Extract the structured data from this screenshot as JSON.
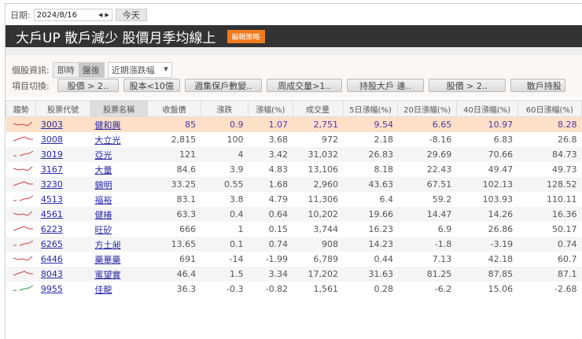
{
  "toolbar": {
    "date_label": "日期:",
    "date_value": "2024/8/16",
    "today_button": "今天"
  },
  "title": {
    "text": "大戶UP 散戶減少 股價月季均線上",
    "edit_button": "編輯策略"
  },
  "stock_info": {
    "label": "個股資訊:",
    "realtime": "即時",
    "after_hours": "盤後",
    "dropdown_value": "近期漲跌幅"
  },
  "item_switch": {
    "label": "項目切換:",
    "buttons": [
      "股價 > 2..",
      "股本<10億",
      "週集保戶數變..",
      "周成交量>1..",
      "持股大戶 連..",
      "股價 > 2..",
      "散戶持股"
    ]
  },
  "table": {
    "headers": [
      "趨勢",
      "股票代號",
      "股票名稱",
      "收盤價",
      "漲跌",
      "漲幅(%)",
      "成交量",
      "5日漲幅(%)",
      "20日漲幅(%)",
      "40日漲幅(%)",
      "60日漲幅(%)"
    ],
    "rows": [
      {
        "code": "3003",
        "name": "健和興",
        "close": "85",
        "chg": "0.9",
        "pct": "1.07",
        "vol": "2,751",
        "d5": "9.54",
        "d20": "6.65",
        "d40": "10.97",
        "d60": "8.28",
        "trend": "red"
      },
      {
        "code": "3008",
        "name": "大立光",
        "close": "2,815",
        "chg": "100",
        "pct": "3.68",
        "vol": "972",
        "d5": "2.18",
        "d20": "-8.16",
        "d40": "6.83",
        "d60": "26.8",
        "trend": "red"
      },
      {
        "code": "3019",
        "name": "亞光",
        "close": "121",
        "chg": "4",
        "pct": "3.42",
        "vol": "31,032",
        "d5": "26.83",
        "d20": "29.69",
        "d40": "70.66",
        "d60": "84.73",
        "trend": "red"
      },
      {
        "code": "3167",
        "name": "大量",
        "close": "84.6",
        "chg": "3.9",
        "pct": "4.83",
        "vol": "13,106",
        "d5": "8.18",
        "d20": "22.43",
        "d40": "49.47",
        "d60": "49.73",
        "trend": "red"
      },
      {
        "code": "3230",
        "name": "錦明",
        "close": "33.25",
        "chg": "0.55",
        "pct": "1.68",
        "vol": "2,960",
        "d5": "43.63",
        "d20": "67.51",
        "d40": "102.13",
        "d60": "128.52",
        "trend": "red"
      },
      {
        "code": "4513",
        "name": "福裕",
        "close": "83.1",
        "chg": "3.8",
        "pct": "4.79",
        "vol": "11,306",
        "d5": "6.4",
        "d20": "59.2",
        "d40": "103.93",
        "d60": "110.11",
        "trend": "red"
      },
      {
        "code": "4561",
        "name": "健椿",
        "close": "63.3",
        "chg": "0.4",
        "pct": "0.64",
        "vol": "10,202",
        "d5": "19.66",
        "d20": "14.47",
        "d40": "14.26",
        "d60": "16.36",
        "trend": "red"
      },
      {
        "code": "6223",
        "name": "旺矽",
        "close": "666",
        "chg": "1",
        "pct": "0.15",
        "vol": "3,744",
        "d5": "16.23",
        "d20": "6.9",
        "d40": "26.86",
        "d60": "50.17",
        "trend": "red"
      },
      {
        "code": "6265",
        "name": "方土昶",
        "close": "13.65",
        "chg": "0.1",
        "pct": "0.74",
        "vol": "908",
        "d5": "14.23",
        "d20": "-1.8",
        "d40": "-3.19",
        "d60": "0.74",
        "trend": "red"
      },
      {
        "code": "6446",
        "name": "藥華藥",
        "close": "691",
        "chg": "-14",
        "pct": "-1.99",
        "vol": "6,789",
        "d5": "0.44",
        "d20": "7.13",
        "d40": "42.18",
        "d60": "60.7",
        "trend": "red"
      },
      {
        "code": "8043",
        "name": "蜜望實",
        "close": "46.4",
        "chg": "1.5",
        "pct": "3.34",
        "vol": "17,202",
        "d5": "31.63",
        "d20": "81.25",
        "d40": "87.85",
        "d60": "87.1",
        "trend": "red"
      },
      {
        "code": "9955",
        "name": "佳龍",
        "close": "36.3",
        "chg": "-0.3",
        "pct": "-0.82",
        "vol": "1,561",
        "d5": "0.28",
        "d20": "-6.2",
        "d40": "15.06",
        "d60": "-2.68",
        "trend": "green"
      }
    ]
  },
  "colors": {
    "title_bg": "#333333",
    "edit": "#f07a1e",
    "highlight": "#fde0c8",
    "link": "#2a2aa8",
    "trend_up": "#d04040",
    "trend_down": "#2a9a3a"
  }
}
